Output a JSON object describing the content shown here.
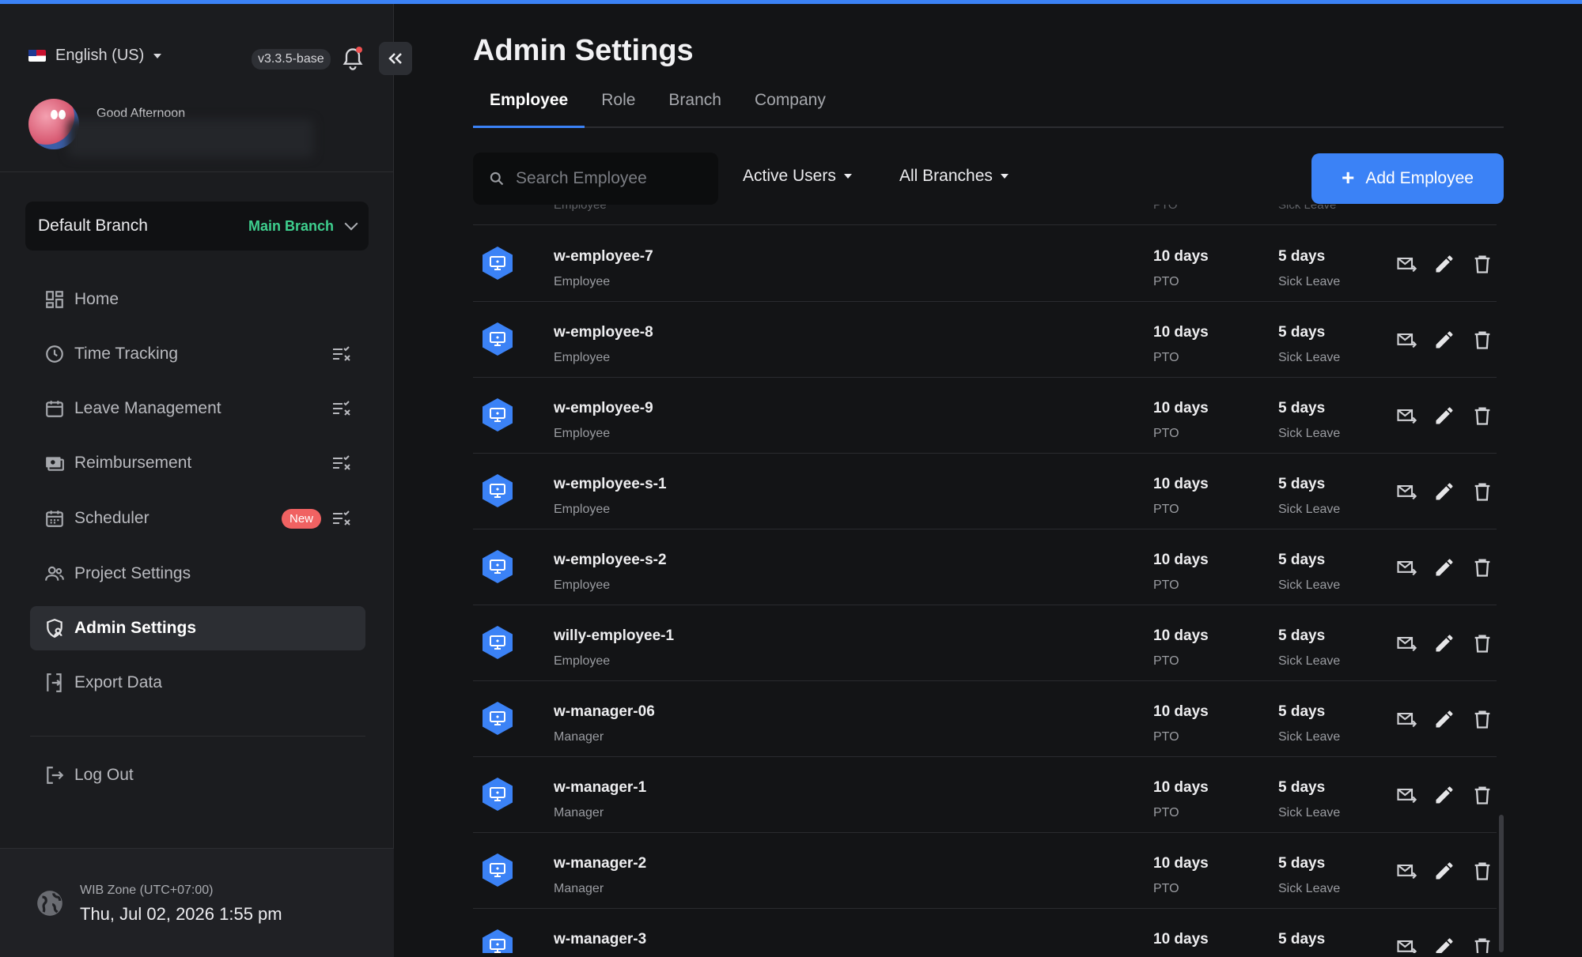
{
  "app": {
    "language": "English (US)",
    "version": "v3.3.5-base",
    "greeting": "Good Afternoon",
    "default_branch_label": "Default Branch",
    "default_branch_value": "Main Branch",
    "accent_color": "#3b82f6",
    "branch_color": "#3ecf8e"
  },
  "sidebar": {
    "items": [
      {
        "label": "Home",
        "icon": "dashboard-icon"
      },
      {
        "label": "Time Tracking",
        "icon": "clock-icon"
      },
      {
        "label": "Leave Management",
        "icon": "calendar-icon"
      },
      {
        "label": "Reimbursement",
        "icon": "money-icon"
      },
      {
        "label": "Scheduler",
        "icon": "schedule-icon",
        "badge": "New"
      },
      {
        "label": "Project Settings",
        "icon": "people-icon"
      },
      {
        "label": "Admin Settings",
        "icon": "shield-user-icon",
        "active": true
      },
      {
        "label": "Export Data",
        "icon": "export-icon"
      }
    ],
    "logout": "Log Out",
    "timezone": "WIB Zone (UTC+07:00)",
    "datetime": "Thu, Jul 02, 2026 1:55 pm"
  },
  "main": {
    "title": "Admin Settings",
    "tabs": [
      "Employee",
      "Role",
      "Branch",
      "Company"
    ],
    "active_tab": "Employee",
    "search_placeholder": "Search Employee",
    "filter_users": "Active Users",
    "filter_branches": "All Branches",
    "add_button": "Add Employee",
    "columns": {
      "name": "Employee",
      "pto": "PTO",
      "sick": "Sick Leave"
    },
    "rows": [
      {
        "name": "w-employee-7",
        "role": "Employee",
        "pto": "10 days",
        "pto_label": "PTO",
        "sick": "5 days",
        "sick_label": "Sick Leave"
      },
      {
        "name": "w-employee-8",
        "role": "Employee",
        "pto": "10 days",
        "pto_label": "PTO",
        "sick": "5 days",
        "sick_label": "Sick Leave"
      },
      {
        "name": "w-employee-9",
        "role": "Employee",
        "pto": "10 days",
        "pto_label": "PTO",
        "sick": "5 days",
        "sick_label": "Sick Leave"
      },
      {
        "name": "w-employee-s-1",
        "role": "Employee",
        "pto": "10 days",
        "pto_label": "PTO",
        "sick": "5 days",
        "sick_label": "Sick Leave"
      },
      {
        "name": "w-employee-s-2",
        "role": "Employee",
        "pto": "10 days",
        "pto_label": "PTO",
        "sick": "5 days",
        "sick_label": "Sick Leave"
      },
      {
        "name": "willy-employee-1",
        "role": "Employee",
        "pto": "10 days",
        "pto_label": "PTO",
        "sick": "5 days",
        "sick_label": "Sick Leave"
      },
      {
        "name": "w-manager-06",
        "role": "Manager",
        "pto": "10 days",
        "pto_label": "PTO",
        "sick": "5 days",
        "sick_label": "Sick Leave"
      },
      {
        "name": "w-manager-1",
        "role": "Manager",
        "pto": "10 days",
        "pto_label": "PTO",
        "sick": "5 days",
        "sick_label": "Sick Leave"
      },
      {
        "name": "w-manager-2",
        "role": "Manager",
        "pto": "10 days",
        "pto_label": "PTO",
        "sick": "5 days",
        "sick_label": "Sick Leave"
      },
      {
        "name": "w-manager-3",
        "role": "",
        "pto": "10 days",
        "pto_label": "",
        "sick": "5 days",
        "sick_label": ""
      }
    ]
  }
}
